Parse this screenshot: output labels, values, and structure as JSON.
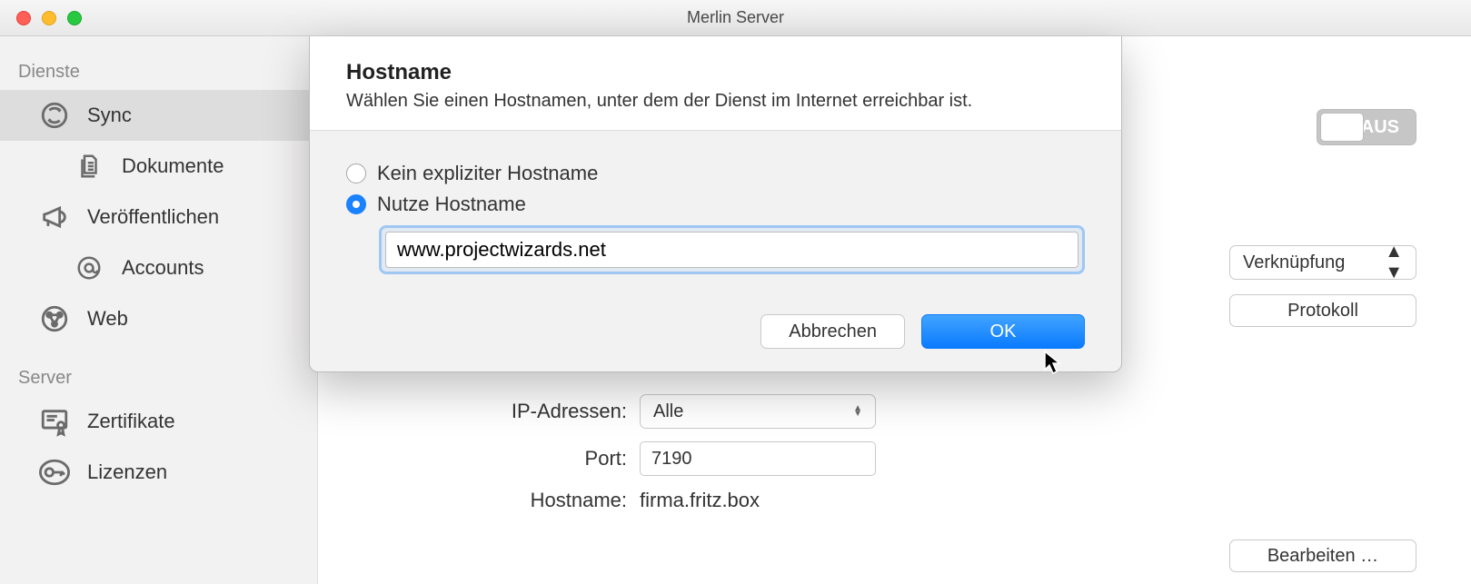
{
  "window": {
    "title": "Merlin Server"
  },
  "sidebar": {
    "groups": [
      {
        "label": "Dienste",
        "items": [
          {
            "label": "Sync"
          },
          {
            "label": "Dokumente"
          },
          {
            "label": "Veröffentlichen"
          },
          {
            "label": "Accounts"
          },
          {
            "label": "Web"
          }
        ]
      },
      {
        "label": "Server",
        "items": [
          {
            "label": "Zertifikate"
          },
          {
            "label": "Lizenzen"
          }
        ]
      }
    ]
  },
  "main": {
    "toggle_label": "AUS",
    "link_select": "Verknüpfung",
    "protokoll_btn": "Protokoll",
    "rows": {
      "ip_label": "IP-Adressen:",
      "ip_value": "Alle",
      "port_label": "Port:",
      "port_value": "7190",
      "hostname_label": "Hostname:",
      "hostname_value": "firma.fritz.box"
    },
    "edit_btn": "Bearbeiten …"
  },
  "sheet": {
    "title": "Hostname",
    "subtitle": "Wählen Sie einen Hostnamen, unter dem der Dienst im Internet erreichbar ist.",
    "radio_none": "Kein expliziter Hostname",
    "radio_use": "Nutze Hostname",
    "input_value": "www.projectwizards.net",
    "cancel": "Abbrechen",
    "ok": "OK"
  }
}
